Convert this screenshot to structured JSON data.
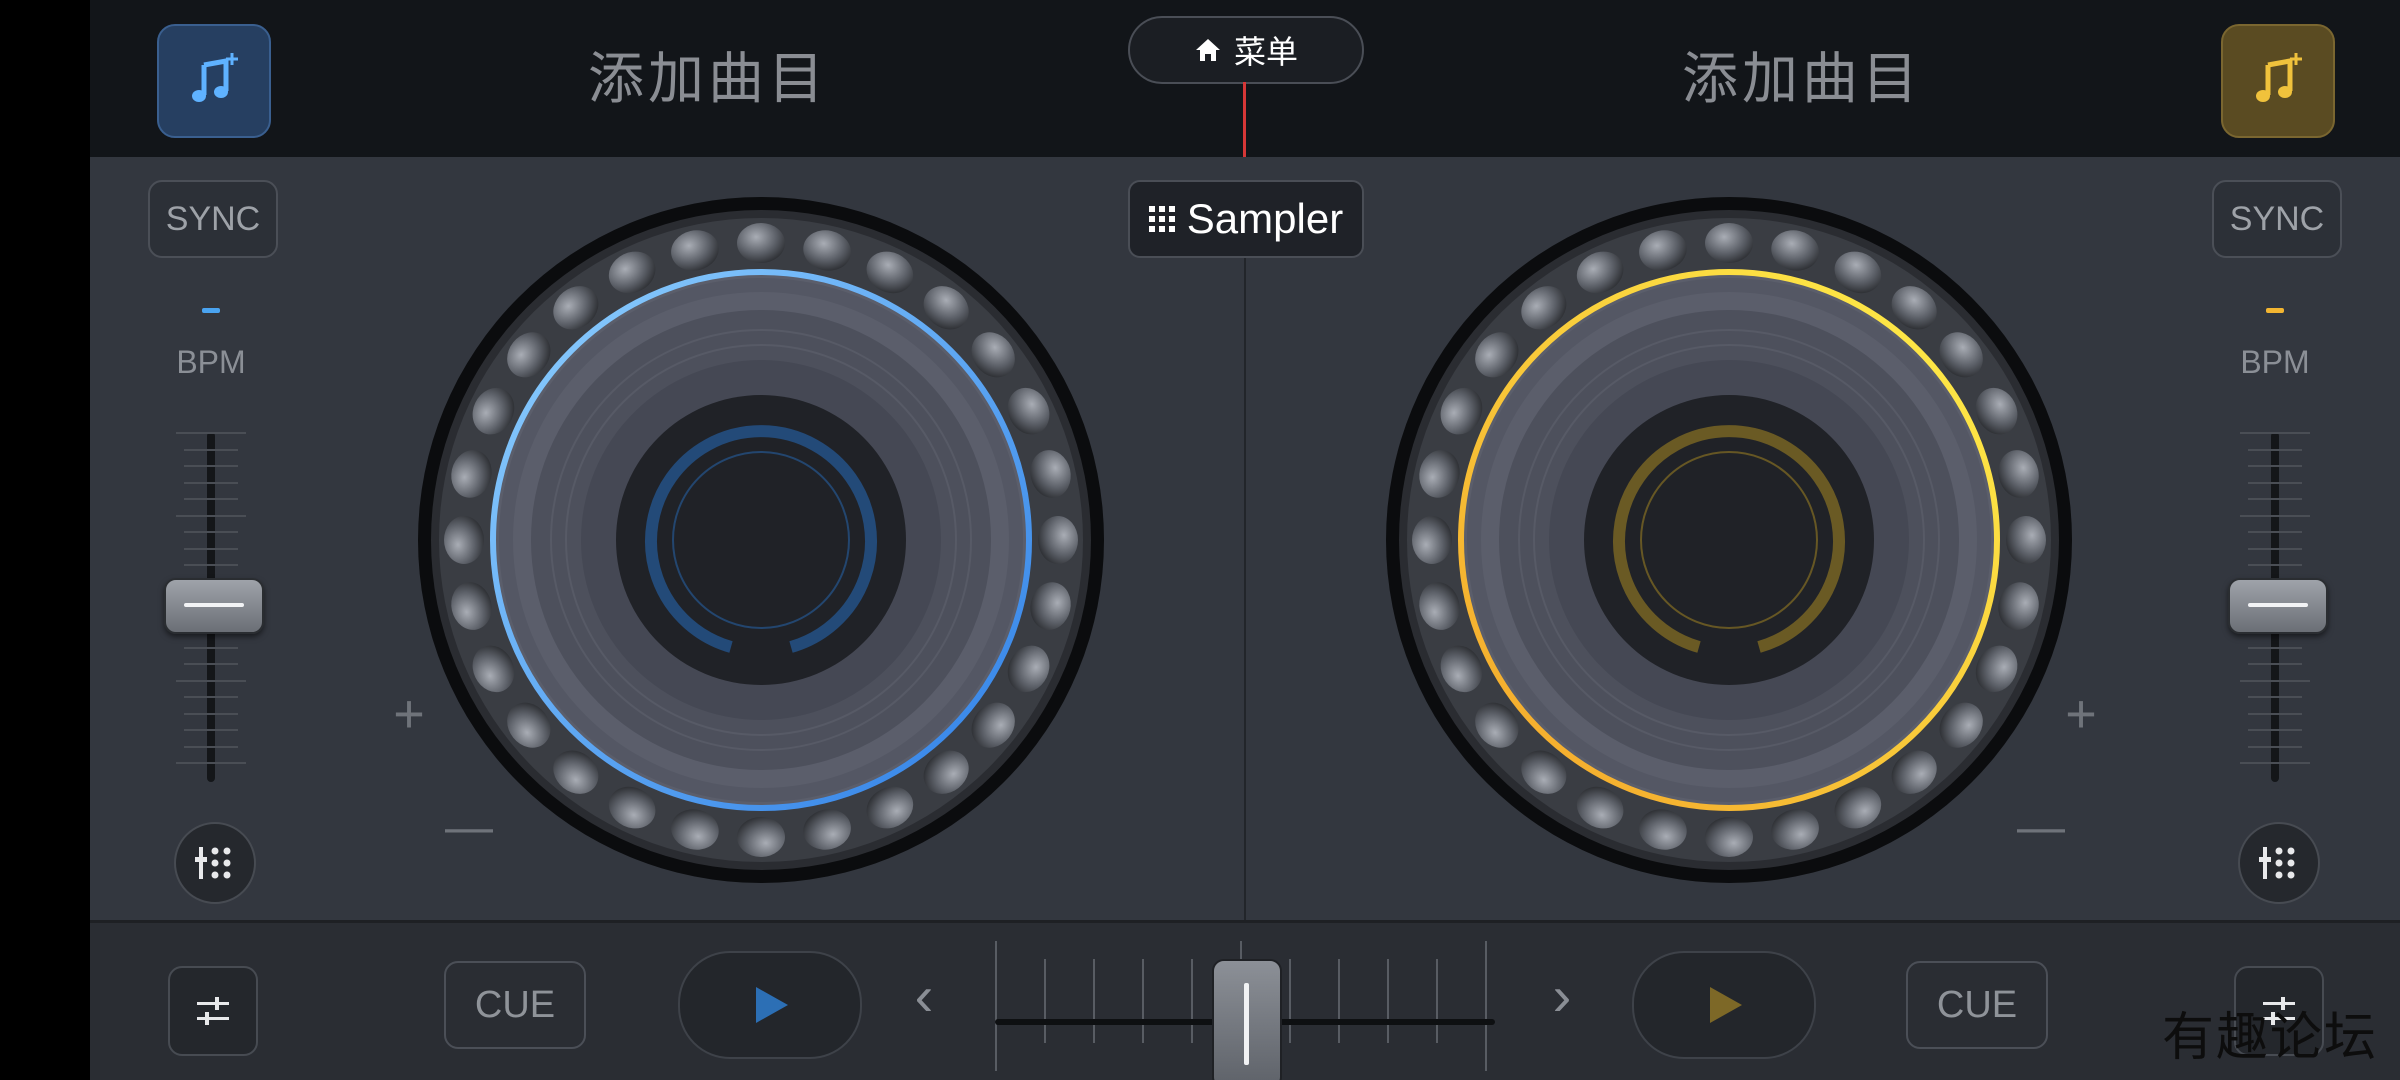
{
  "header": {
    "left_add_title": "添加曲目",
    "right_add_title": "添加曲目",
    "menu_label": "菜单",
    "menu_icon": "home-icon",
    "add_icon": "music-note-plus-icon"
  },
  "center": {
    "sampler_label": "Sampler",
    "sampler_icon": "grid-icon"
  },
  "deck_left": {
    "sync_label": "SYNC",
    "bpm_value": "-",
    "bpm_label": "BPM",
    "cue_label": "CUE",
    "accent": "#4aa3f0",
    "plus": "+",
    "minus": "—"
  },
  "deck_right": {
    "sync_label": "SYNC",
    "bpm_value": "-",
    "bpm_label": "BPM",
    "cue_label": "CUE",
    "accent": "#f3c12e",
    "plus": "+",
    "minus": "—"
  },
  "transport": {
    "prev_arrow": "‹",
    "next_arrow": "›"
  },
  "watermark": "有趣论坛"
}
